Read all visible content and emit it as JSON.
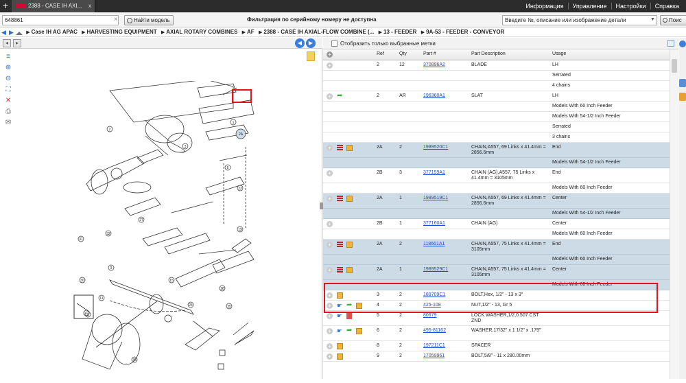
{
  "tab": {
    "title": "2388 - CASE IH AXI...",
    "new_tab": "+",
    "close": "x"
  },
  "topmenu": [
    "Информация",
    "Управление",
    "Настройки",
    "Справка"
  ],
  "toolbar": {
    "serial_value": "648861",
    "find_model_label": "Найти модель",
    "serial_message": "Фильтрация по серийному номеру не доступна",
    "search_placeholder": "Введите №, описание или изображение детали",
    "search_label": "Поис"
  },
  "breadcrumb": [
    "Case IH AG APAC",
    "HARVESTING EQUIPMENT",
    "AXIAL ROTARY COMBINES",
    "AF",
    "2388 - CASE IH AXIAL-FLOW COMBINE (...",
    "13 - FEEDER",
    "9A-53 - FEEDER - CONVEYOR"
  ],
  "parts_panel": {
    "show_selected_label": "Отобразить только выбранные метки"
  },
  "table": {
    "headers": [
      "Ref",
      "Qty",
      "Part #",
      "Part Description",
      "Usage"
    ],
    "rows": [
      {
        "ref": "2",
        "qty": "12",
        "part": "370896A2",
        "desc": "BLADE",
        "usage": [
          "LH",
          "Serrated",
          "4 chains"
        ],
        "highlight": false,
        "icons": []
      },
      {
        "ref": "2",
        "qty": "AR",
        "part": "196360A1",
        "desc": "SLAT",
        "usage": [
          "LH",
          "Models With 60 Inch Feeder",
          "Models With 54-1/2 Inch Feeder",
          "Serrated",
          "3 chains"
        ],
        "highlight": false,
        "icons": [
          "arrow"
        ]
      },
      {
        "ref": "2A",
        "qty": "2",
        "part": "1989520C1",
        "desc": "CHAIN,A557, 69 Links x 41.4mm = 2856.6mm",
        "usage": [
          "End",
          "Models With 54-1/2 Inch Feeder"
        ],
        "highlight": true,
        "icons": [
          "list",
          "box"
        ]
      },
      {
        "ref": "2B",
        "qty": "3",
        "part": "377159A1",
        "desc": "CHAIN (AG),A557, 75 Links x 41.4mm = 3105mm",
        "usage": [
          "End",
          "Models With 60 Inch Feeder"
        ],
        "highlight": false,
        "icons": []
      },
      {
        "ref": "2A",
        "qty": "1",
        "part": "1989519C1",
        "desc": "CHAIN,A557, 69 Links x 41.4mm = 2856.6mm",
        "usage": [
          "Center",
          "Models With 54-1/2 Inch Feeder"
        ],
        "highlight": true,
        "icons": [
          "list",
          "box"
        ]
      },
      {
        "ref": "2B",
        "qty": "1",
        "part": "377160A1",
        "desc": "CHAIN (AG)",
        "usage": [
          "Center",
          "Models With 60 Inch Feeder"
        ],
        "highlight": false,
        "icons": []
      },
      {
        "ref": "2A",
        "qty": "2",
        "part": "118661A1",
        "desc": "CHAIN,A557, 75 Links x 41.4mm = 3105mm",
        "usage": [
          "End",
          "Models With 60 Inch Feeder"
        ],
        "highlight": true,
        "icons": [
          "list",
          "box"
        ]
      },
      {
        "ref": "2A",
        "qty": "1",
        "part": "1989529C1",
        "desc": "CHAIN,A557, 75 Links x 41.4mm = 3105mm",
        "usage": [
          "Center",
          "Models With 60 Inch Feeder"
        ],
        "highlight": true,
        "icons": [
          "list",
          "box"
        ]
      },
      {
        "ref": "3",
        "qty": "2",
        "part": "189709C1",
        "desc": "BOLT,Hex, 1/2\" - 13 x 3\"",
        "usage": [],
        "highlight": false,
        "icons": [
          "box"
        ]
      },
      {
        "ref": "4",
        "qty": "2",
        "part": "425-108",
        "desc": "NUT,1/2\" - 13, Gr 5",
        "usage": [],
        "highlight": false,
        "icons": [
          "hand",
          "arrow",
          "box"
        ]
      },
      {
        "ref": "5",
        "qty": "2",
        "part": "80679",
        "desc": "LOCK WASHER,1/2,0.507 CST ZND",
        "usage": [],
        "highlight": false,
        "icons": [
          "hand",
          "book"
        ]
      },
      {
        "ref": "6",
        "qty": "2",
        "part": "495-81162",
        "desc": "WASHER,17/32\" x 1 1/2\" x .179\"",
        "usage": [],
        "highlight": false,
        "icons": [
          "hand",
          "arrow",
          "box"
        ]
      },
      {
        "ref": "8",
        "qty": "2",
        "part": "197211C1",
        "desc": "SPACER",
        "usage": [],
        "highlight": false,
        "icons": [
          "box"
        ]
      },
      {
        "ref": "9",
        "qty": "2",
        "part": "17059961",
        "desc": "BOLT,5/8\" - 11 x 280.00mm",
        "usage": [],
        "highlight": false,
        "icons": [
          "box"
        ]
      }
    ]
  },
  "diagram": {
    "callouts": [
      "2A",
      "1",
      "2",
      "3",
      "31",
      "30",
      "32",
      "37",
      "24",
      "28",
      "35",
      "36",
      "11",
      "15",
      "9",
      "6",
      "27",
      "19",
      "22"
    ]
  },
  "colors": {
    "accent": "#3b7dd8",
    "highlight_row": "#cddbe7",
    "red_box": "#e0141b"
  }
}
